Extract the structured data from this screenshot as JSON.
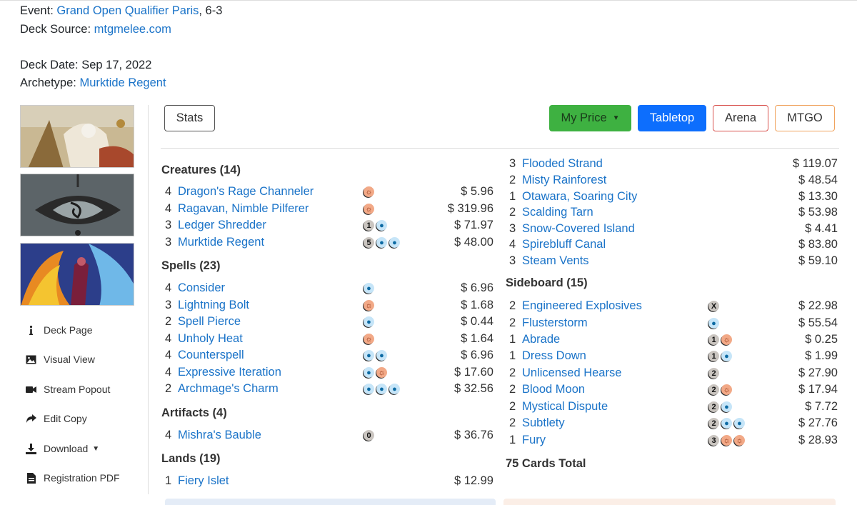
{
  "meta": {
    "event_label": "Event: ",
    "event_name": "Grand Open Qualifier Paris",
    "event_result": ", 6-3",
    "source_label": "Deck Source: ",
    "source_link": "mtgmelee.com",
    "date_label": "Deck Date: ",
    "date_value": "Sep 17, 2022",
    "archetype_label": "Archetype: ",
    "archetype_link": "Murktide Regent"
  },
  "sidebar": {
    "items": [
      {
        "label": "Deck Page",
        "icon": "info-icon"
      },
      {
        "label": "Visual View",
        "icon": "image-icon"
      },
      {
        "label": "Stream Popout",
        "icon": "video-camera-icon"
      },
      {
        "label": "Edit Copy",
        "icon": "share-arrow-icon"
      },
      {
        "label": "Download",
        "icon": "download-icon"
      },
      {
        "label": "Registration PDF",
        "icon": "pdf-file-icon"
      }
    ]
  },
  "toolbar": {
    "stats": "Stats",
    "my_price": "My Price",
    "tabletop": "Tabletop",
    "arena": "Arena",
    "mtgo": "MTGO"
  },
  "colors": {
    "link": "#1a73c8",
    "green": "#3eb141",
    "blue": "#0d6efd",
    "arena_border": "#d9534f",
    "mtgo_border": "#f0a35e",
    "mana_blue": "#c6e5f8",
    "mana_red": "#f2a987",
    "mana_generic": "#cac5c0"
  },
  "sections_left": [
    {
      "title": "Creatures (14)",
      "cards": [
        {
          "qty": "4",
          "name": "Dragon's Rage Channeler",
          "mana": [
            "R"
          ],
          "price": "$ 5.96"
        },
        {
          "qty": "4",
          "name": "Ragavan, Nimble Pilferer",
          "mana": [
            "R"
          ],
          "price": "$ 319.96"
        },
        {
          "qty": "3",
          "name": "Ledger Shredder",
          "mana": [
            "1",
            "U"
          ],
          "price": "$ 71.97"
        },
        {
          "qty": "3",
          "name": "Murktide Regent",
          "mana": [
            "5",
            "U",
            "U"
          ],
          "price": "$ 48.00"
        }
      ]
    },
    {
      "title": "Spells (23)",
      "cards": [
        {
          "qty": "4",
          "name": "Consider",
          "mana": [
            "U"
          ],
          "price": "$ 6.96"
        },
        {
          "qty": "3",
          "name": "Lightning Bolt",
          "mana": [
            "R"
          ],
          "price": "$ 1.68"
        },
        {
          "qty": "2",
          "name": "Spell Pierce",
          "mana": [
            "U"
          ],
          "price": "$ 0.44"
        },
        {
          "qty": "4",
          "name": "Unholy Heat",
          "mana": [
            "R"
          ],
          "price": "$ 1.64"
        },
        {
          "qty": "4",
          "name": "Counterspell",
          "mana": [
            "U",
            "U"
          ],
          "price": "$ 6.96"
        },
        {
          "qty": "4",
          "name": "Expressive Iteration",
          "mana": [
            "U",
            "R"
          ],
          "price": "$ 17.60"
        },
        {
          "qty": "2",
          "name": "Archmage's Charm",
          "mana": [
            "U",
            "U",
            "U"
          ],
          "price": "$ 32.56"
        }
      ]
    },
    {
      "title": "Artifacts (4)",
      "cards": [
        {
          "qty": "4",
          "name": "Mishra's Bauble",
          "mana": [
            "0"
          ],
          "price": "$ 36.76"
        }
      ]
    },
    {
      "title": "Lands (19)",
      "cards": [
        {
          "qty": "1",
          "name": "Fiery Islet",
          "mana": [],
          "price": "$ 12.99"
        }
      ]
    }
  ],
  "lands_right": [
    {
      "qty": "3",
      "name": "Flooded Strand",
      "price": "$ 119.07"
    },
    {
      "qty": "2",
      "name": "Misty Rainforest",
      "price": "$ 48.54"
    },
    {
      "qty": "1",
      "name": "Otawara, Soaring City",
      "price": "$ 13.30"
    },
    {
      "qty": "2",
      "name": "Scalding Tarn",
      "price": "$ 53.98"
    },
    {
      "qty": "3",
      "name": "Snow-Covered Island",
      "price": "$ 4.41"
    },
    {
      "qty": "4",
      "name": "Spirebluff Canal",
      "price": "$ 83.80"
    },
    {
      "qty": "3",
      "name": "Steam Vents",
      "price": "$ 59.10"
    }
  ],
  "sideboard": {
    "title": "Sideboard (15)",
    "cards": [
      {
        "qty": "2",
        "name": "Engineered Explosives",
        "mana": [
          "X"
        ],
        "price": "$ 22.98"
      },
      {
        "qty": "2",
        "name": "Flusterstorm",
        "mana": [
          "U"
        ],
        "price": "$ 55.54"
      },
      {
        "qty": "1",
        "name": "Abrade",
        "mana": [
          "1",
          "R"
        ],
        "price": "$ 0.25"
      },
      {
        "qty": "1",
        "name": "Dress Down",
        "mana": [
          "1",
          "U"
        ],
        "price": "$ 1.99"
      },
      {
        "qty": "2",
        "name": "Unlicensed Hearse",
        "mana": [
          "2"
        ],
        "price": "$ 27.90"
      },
      {
        "qty": "2",
        "name": "Blood Moon",
        "mana": [
          "2",
          "R"
        ],
        "price": "$ 17.94"
      },
      {
        "qty": "2",
        "name": "Mystical Dispute",
        "mana": [
          "2",
          "U"
        ],
        "price": "$ 7.72"
      },
      {
        "qty": "2",
        "name": "Subtlety",
        "mana": [
          "2",
          "U",
          "U"
        ],
        "price": "$ 27.76"
      },
      {
        "qty": "1",
        "name": "Fury",
        "mana": [
          "3",
          "R",
          "R"
        ],
        "price": "$ 28.93"
      }
    ]
  },
  "total": "75 Cards Total"
}
